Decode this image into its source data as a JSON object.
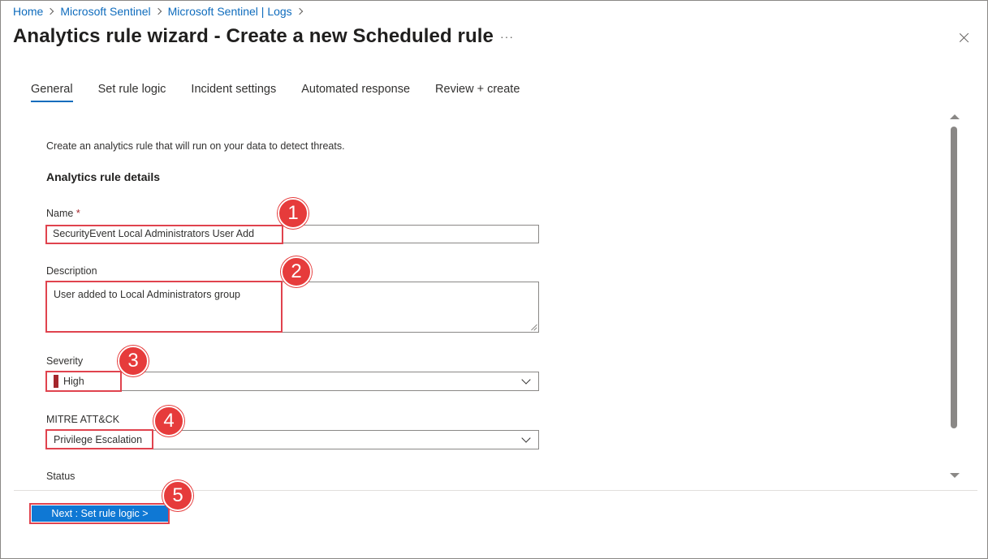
{
  "breadcrumb": {
    "items": [
      "Home",
      "Microsoft Sentinel",
      "Microsoft Sentinel | Logs"
    ]
  },
  "header": {
    "title": "Analytics rule wizard - Create a new Scheduled rule",
    "more_label": "···"
  },
  "tabs": [
    {
      "label": "General",
      "active": true
    },
    {
      "label": "Set rule logic",
      "active": false
    },
    {
      "label": "Incident settings",
      "active": false
    },
    {
      "label": "Automated response",
      "active": false
    },
    {
      "label": "Review + create",
      "active": false
    }
  ],
  "form": {
    "intro": "Create an analytics rule that will run on your data to detect threats.",
    "section_title": "Analytics rule details",
    "name": {
      "label": "Name",
      "required_mark": "*",
      "value": "SecurityEvent Local Administrators User Add"
    },
    "description": {
      "label": "Description",
      "value": "User added to Local Administrators group"
    },
    "severity": {
      "label": "Severity",
      "value": "High",
      "color": "#a4262c"
    },
    "mitre": {
      "label": "MITRE ATT&CK",
      "value": "Privilege Escalation"
    },
    "status": {
      "label": "Status"
    }
  },
  "footer": {
    "next_label": "Next : Set rule logic >"
  },
  "annotations": [
    "1",
    "2",
    "3",
    "4",
    "5"
  ],
  "colors": {
    "accent": "#0f6cbd",
    "button": "#0f78d4",
    "annotation": "#e63b3b"
  }
}
